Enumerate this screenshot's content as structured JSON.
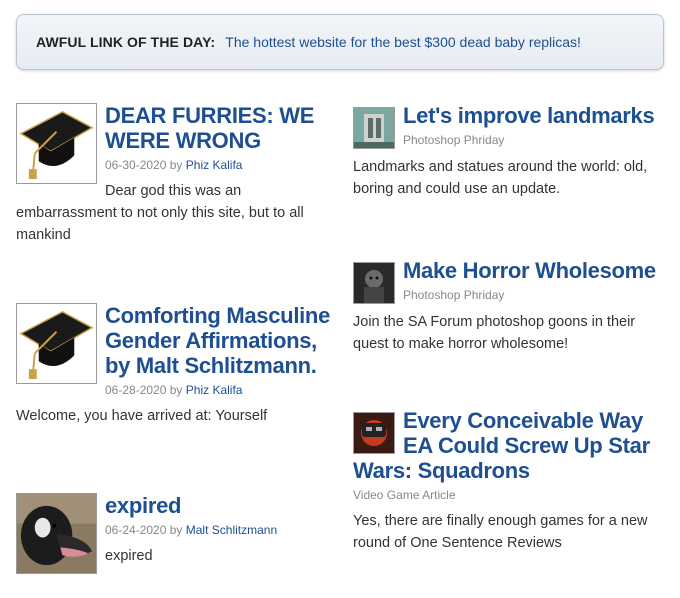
{
  "awful_link": {
    "label": "AWFUL LINK OF THE DAY:",
    "link_text": "The hottest website for the best $300 dead baby replicas!"
  },
  "left_articles": [
    {
      "title": "DEAR FURRIES: WE WERE WRONG",
      "date": "06-30-2020",
      "by": "by",
      "author": "Phiz Kalifa",
      "description": "Dear god this was an embarrassment to not only this site, but to all mankind",
      "thumb_icon": "graduation-cap-icon"
    },
    {
      "title": "Comforting Masculine Gender Affirmations, by Malt Schlitzmann.",
      "date": "06-28-2020",
      "by": "by",
      "author": "Phiz Kalifa",
      "description": "Welcome, you have arrived at: Yourself",
      "thumb_icon": "graduation-cap-icon"
    },
    {
      "title": "expired",
      "date": "06-24-2020",
      "by": "by",
      "author": "Malt Schlitzmann",
      "description": "expired",
      "thumb_icon": "goose-photo"
    }
  ],
  "right_articles": [
    {
      "title": "Let's improve landmarks",
      "category": "Photoshop Phriday",
      "description": "Landmarks and statues around the world: old, boring and could use an update.",
      "thumb_icon": "landmark-photo"
    },
    {
      "title": "Make Horror Wholesome",
      "category": "Photoshop Phriday",
      "description": "Join the SA Forum photoshop goons in their quest to make horror wholesome!",
      "thumb_icon": "horror-photo"
    },
    {
      "title": "Every Conceivable Way EA Could Screw Up Star Wars: Squadrons",
      "category": "Video Game Article",
      "description": "Yes, there are finally enough games for a new round of One Sentence Reviews",
      "thumb_icon": "starwars-photo"
    }
  ],
  "colors": {
    "link_blue": "#1d4f91",
    "meta_gray": "#888888",
    "box_border": "#b9c4d2"
  }
}
